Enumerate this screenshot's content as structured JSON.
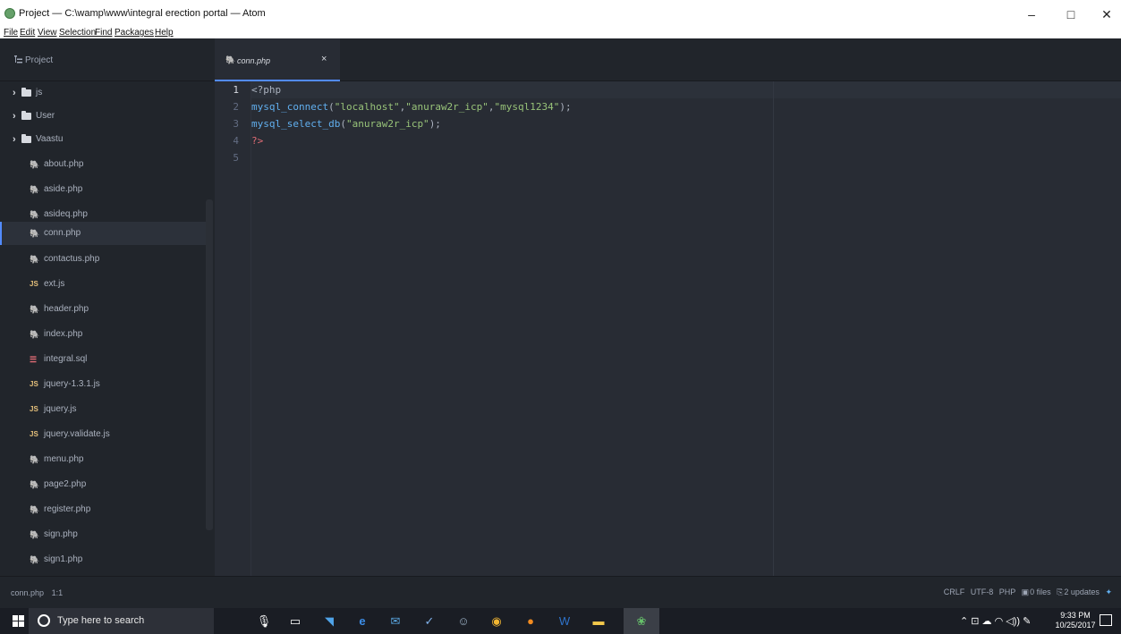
{
  "window": {
    "title": "Project — C:\\wamp\\www\\integral erection portal — Atom",
    "minimize_glyph": "–",
    "maximize_glyph": "□",
    "close_glyph": "✕"
  },
  "menu": {
    "items": [
      "File",
      "Edit",
      "View",
      "Selection",
      "Find",
      "Packages",
      "Help"
    ]
  },
  "tree_view": {
    "header_label": "Project",
    "folders": [
      "js",
      "User",
      "Vaastu"
    ],
    "files": [
      {
        "name": "about.php",
        "type": "php"
      },
      {
        "name": "aside.php",
        "type": "php"
      },
      {
        "name": "asideq.php",
        "type": "php"
      },
      {
        "name": "conn.php",
        "type": "php",
        "selected": true
      },
      {
        "name": "contactus.php",
        "type": "php"
      },
      {
        "name": "ext.js",
        "type": "js"
      },
      {
        "name": "header.php",
        "type": "php"
      },
      {
        "name": "index.php",
        "type": "php"
      },
      {
        "name": "integral.sql",
        "type": "sql"
      },
      {
        "name": "jquery-1.3.1.js",
        "type": "js"
      },
      {
        "name": "jquery.js",
        "type": "js"
      },
      {
        "name": "jquery.validate.js",
        "type": "js"
      },
      {
        "name": "menu.php",
        "type": "php"
      },
      {
        "name": "page2.php",
        "type": "php"
      },
      {
        "name": "register.php",
        "type": "php"
      },
      {
        "name": "sign.php",
        "type": "php"
      },
      {
        "name": "sign1.php",
        "type": "php"
      }
    ]
  },
  "icons": {
    "php": "elephant-icon",
    "js_text": "JS",
    "sql": "database-icon",
    "chevron": "›",
    "close": "×"
  },
  "tab": {
    "label": "conn.php",
    "close": "×"
  },
  "editor": {
    "line_numbers": [
      "1",
      "2",
      "3",
      "4",
      "5"
    ],
    "lines": {
      "l1_tag": "<?php",
      "l2_fn": "mysql_connect",
      "l2_open": "(",
      "l2_s1": "\"localhost\"",
      "l2_c1": ",",
      "l2_s2": "\"anuraw2r_icp\"",
      "l2_c2": ",",
      "l2_s3": "\"mysql1234\"",
      "l2_close": ");",
      "l3_fn": "mysql_select_db",
      "l3_open": "(",
      "l3_s1": "\"anuraw2r_icp\"",
      "l3_close": ");",
      "l4_tag": "?>"
    }
  },
  "status_bar": {
    "file": "conn.php",
    "cursor": "1:1",
    "line_ending": "CRLF",
    "encoding": "UTF-8",
    "grammar": "PHP",
    "git_files": "0 files",
    "updates": "2 updates"
  },
  "taskbar": {
    "search_placeholder": "Type here to search",
    "time": "9:33 PM",
    "date": "10/25/2017",
    "tray_glyphs": "⌃ ⊡ ☁ ◠ ◁)) ✎"
  },
  "colors": {
    "tree_bg": "#21252b",
    "editor_bg": "#282c34",
    "accent": "#528bff",
    "function": "#61afef",
    "string": "#98c379",
    "php_tag": "#e06c75"
  }
}
